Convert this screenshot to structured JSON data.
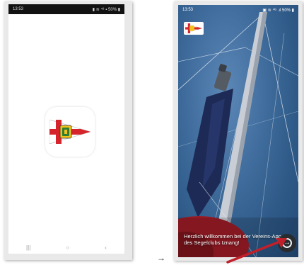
{
  "left_phone": {
    "status_time": "13:53",
    "status_right": "▮ ≋ ⁴⁸ ▪ 50% ▮",
    "nav_back": "‹",
    "nav_home": "○",
    "nav_recent": "|||"
  },
  "right_phone": {
    "status_time": "13:53",
    "status_right": "▣ ≋ ⁴ᴳ .ıl 50% ▮",
    "welcome_text": "Herzlich willkommen bei der Vereins-App des Segelclubs Iznang!",
    "next_symbol": "→"
  },
  "transition_glyph": "→",
  "colors": {
    "flag_red": "#d5242b",
    "flag_yellow": "#f2c21a",
    "sky": "#3f6c9c",
    "arrow_red": "#c0202a"
  },
  "icons": [
    "app-icon",
    "flag-icon",
    "arrow-right-icon"
  ]
}
